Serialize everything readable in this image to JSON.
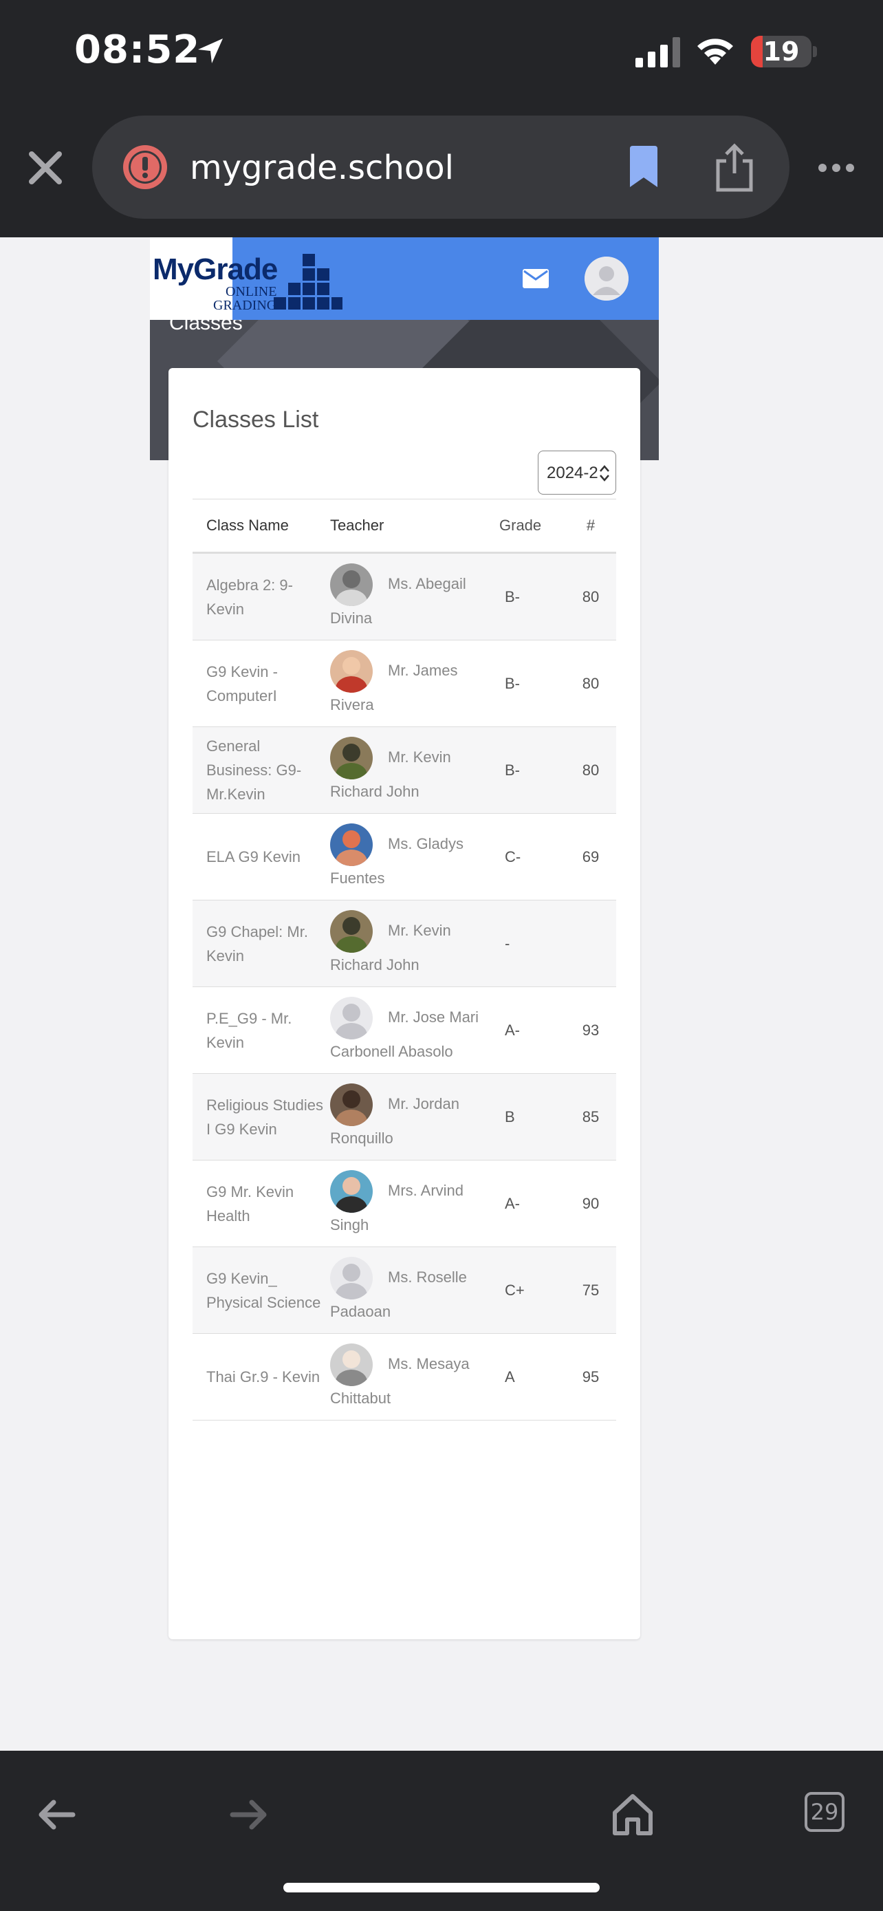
{
  "status_bar": {
    "time": "08:52",
    "battery": "19",
    "battery_level": 0.19
  },
  "browser": {
    "url": "mygrade.school",
    "tab_count": "29"
  },
  "site": {
    "logo_text": "MyGrade",
    "logo_sub1": "ONLINE",
    "logo_sub2": "GRADING",
    "page_heading": "Classes"
  },
  "card": {
    "title": "Classes List",
    "year_select": "2024-2",
    "columns": {
      "class_name": "Class Name",
      "teacher": "Teacher",
      "grade": "Grade",
      "count": "#"
    },
    "rows": [
      {
        "class_name": "Algebra 2: 9-Kevin",
        "teacher": "Ms. Abegail Divina",
        "grade": "B-",
        "count": "80"
      },
      {
        "class_name": "G9 Kevin - ComputerI",
        "teacher": "Mr. James Rivera",
        "grade": "B-",
        "count": "80"
      },
      {
        "class_name": "General Business: G9-Mr.Kevin",
        "teacher": "Mr. Kevin Richard John",
        "grade": "B-",
        "count": "80"
      },
      {
        "class_name": "ELA G9 Kevin",
        "teacher": "Ms. Gladys Fuentes",
        "grade": "C-",
        "count": "69"
      },
      {
        "class_name": "G9 Chapel: Mr. Kevin",
        "teacher": "Mr. Kevin Richard John",
        "grade": "-",
        "count": ""
      },
      {
        "class_name": "P.E_G9 - Mr. Kevin",
        "teacher": "Mr. Jose Mari Carbonell Abasolo",
        "grade": "A-",
        "count": "93"
      },
      {
        "class_name": "Religious Studies I G9 Kevin",
        "teacher": "Mr. Jordan Ronquillo",
        "grade": "B",
        "count": "85"
      },
      {
        "class_name": "G9 Mr. Kevin Health",
        "teacher": "Mrs. Arvind Singh",
        "grade": "A-",
        "count": "90"
      },
      {
        "class_name": "G9 Kevin_ Physical Science",
        "teacher": "Ms. Roselle Padaoan",
        "grade": "C+",
        "count": "75"
      },
      {
        "class_name": "Thai Gr.9 - Kevin",
        "teacher": "Ms. Mesaya Chittabut",
        "grade": "A",
        "count": "95"
      }
    ]
  },
  "colors": {
    "nav_blue": "#4a86e8",
    "browser_dark": "#242528",
    "logo_navy": "#0b2a6b",
    "battery_red": "#e5443d"
  }
}
